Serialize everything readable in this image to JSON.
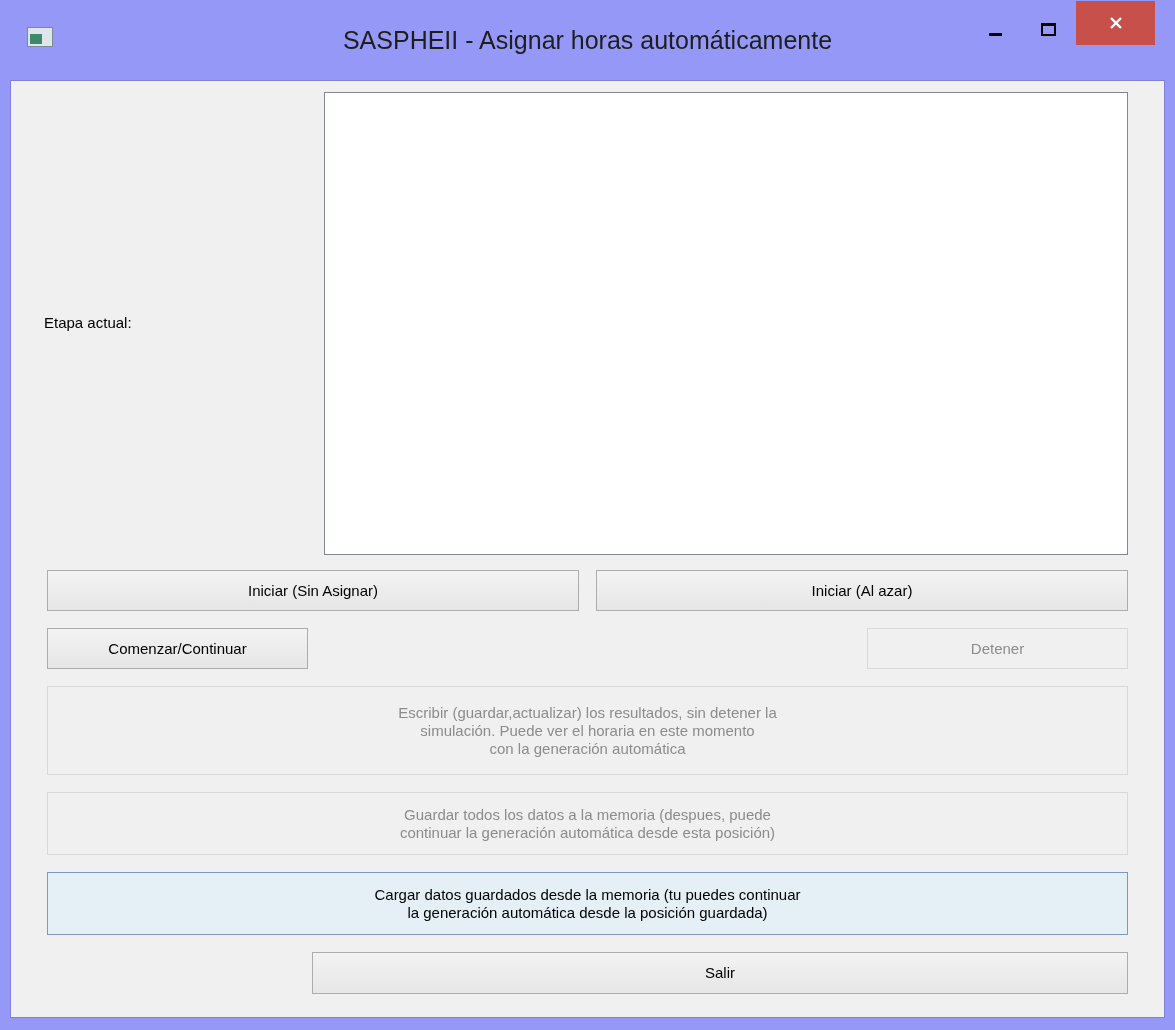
{
  "window": {
    "title": "SASPHEII - Asignar horas automáticamente"
  },
  "stage": {
    "label": "Etapa actual:"
  },
  "start_buttons": [
    {
      "label": "Iniciar (Sin Asignar)",
      "disabled": false
    },
    {
      "label": "Iniciar (Al azar)",
      "disabled": false
    }
  ],
  "control_buttons": [
    {
      "label": "Comenzar/Continuar",
      "disabled": false
    },
    {
      "label": "Detener",
      "disabled": true
    }
  ],
  "action_buttons": [
    {
      "lines": [
        "Escribir (guardar,actualizar) los resultados, sin detener la",
        "simulación. Puede ver el horaria en este momento",
        "con la generación automática"
      ],
      "disabled": true,
      "focused": false
    },
    {
      "lines": [
        "Guardar todos los datos a la memoria (despues, puede",
        "continuar la generación automática desde esta posición)"
      ],
      "disabled": true,
      "focused": false
    },
    {
      "lines": [
        "Cargar datos guardados desde la memoria (tu puedes continuar",
        "la generación automática desde la posición guardada)"
      ],
      "disabled": false,
      "focused": true
    }
  ],
  "exit_button": {
    "label": "Salir",
    "disabled": false
  }
}
